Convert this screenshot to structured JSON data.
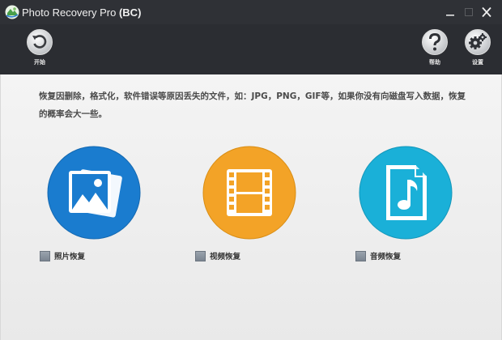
{
  "window": {
    "title": "Photo Recovery Pro",
    "title_suffix": "(BC)"
  },
  "toolbar": {
    "start_label": "开始",
    "help_label": "帮助",
    "settings_label": "设置"
  },
  "content": {
    "description_line1": "恢复因删除，格式化，软件错误等原因丢失的文件，如：JPG，PNG，GIF等，如果你没有向磁盘写入数据，恢复",
    "description_line2": "的概率会大一些。",
    "options": [
      {
        "label": "照片恢复",
        "icon": "photo-icon",
        "color": "#1a7ccf",
        "checked": false
      },
      {
        "label": "视频恢复",
        "icon": "film-icon",
        "color": "#f3a327",
        "checked": false
      },
      {
        "label": "音频恢复",
        "icon": "music-file-icon",
        "color": "#1ab0d8",
        "checked": false
      }
    ]
  }
}
